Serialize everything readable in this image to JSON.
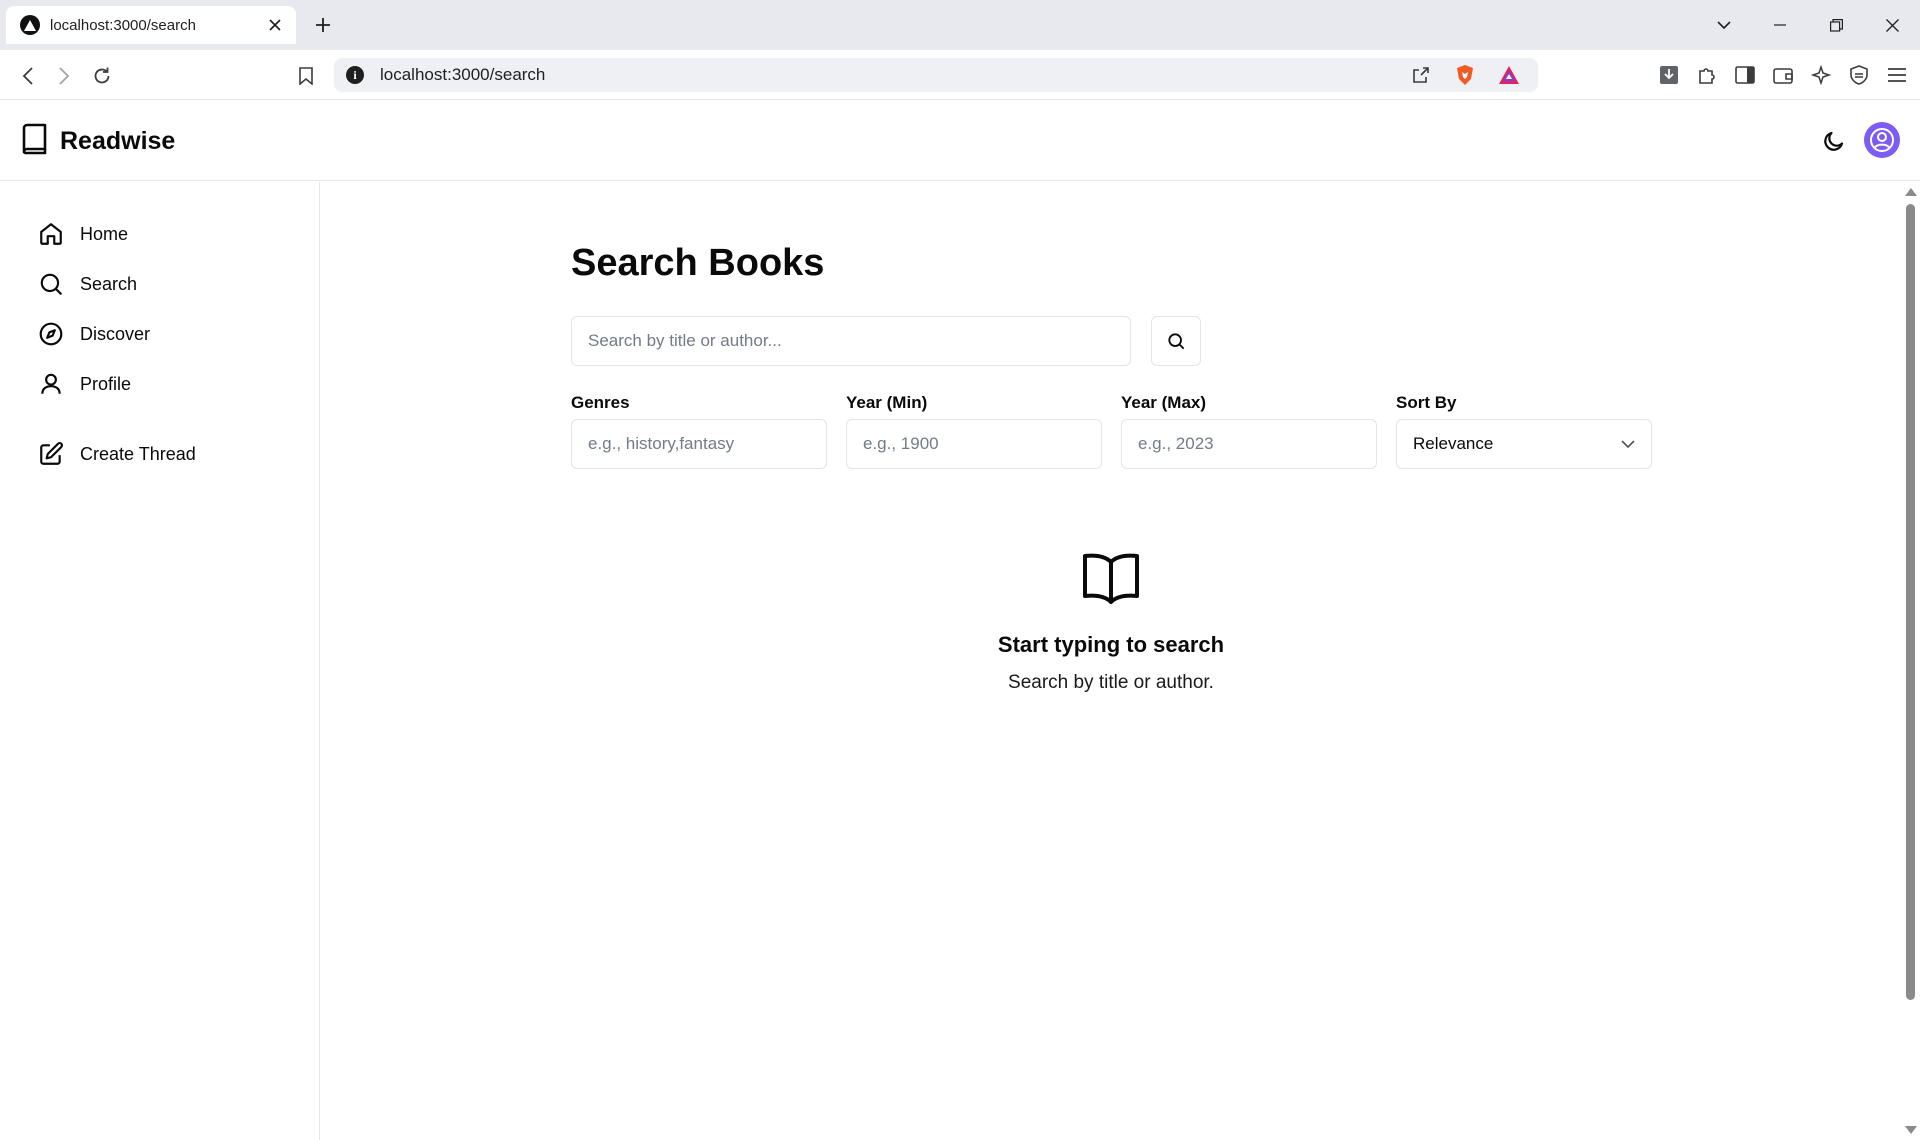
{
  "browser": {
    "tab_title": "localhost:3000/search",
    "url": "localhost:3000/search"
  },
  "app": {
    "brand": "Readwise",
    "accent_color": "#7c5cf2"
  },
  "sidebar": {
    "items": [
      {
        "label": "Home",
        "icon": "home-icon"
      },
      {
        "label": "Search",
        "icon": "search-icon"
      },
      {
        "label": "Discover",
        "icon": "compass-icon"
      },
      {
        "label": "Profile",
        "icon": "user-icon"
      },
      {
        "label": "Create Thread",
        "icon": "edit-icon"
      }
    ]
  },
  "main": {
    "title": "Search Books",
    "search_placeholder": "Search by title or author...",
    "filters": {
      "genres_label": "Genres",
      "genres_placeholder": "e.g., history,fantasy",
      "year_min_label": "Year (Min)",
      "year_min_placeholder": "e.g., 1900",
      "year_max_label": "Year (Max)",
      "year_max_placeholder": "e.g., 2023",
      "sort_label": "Sort By",
      "sort_value": "Relevance"
    },
    "empty_state": {
      "title": "Start typing to search",
      "subtitle": "Search by title or author."
    }
  }
}
